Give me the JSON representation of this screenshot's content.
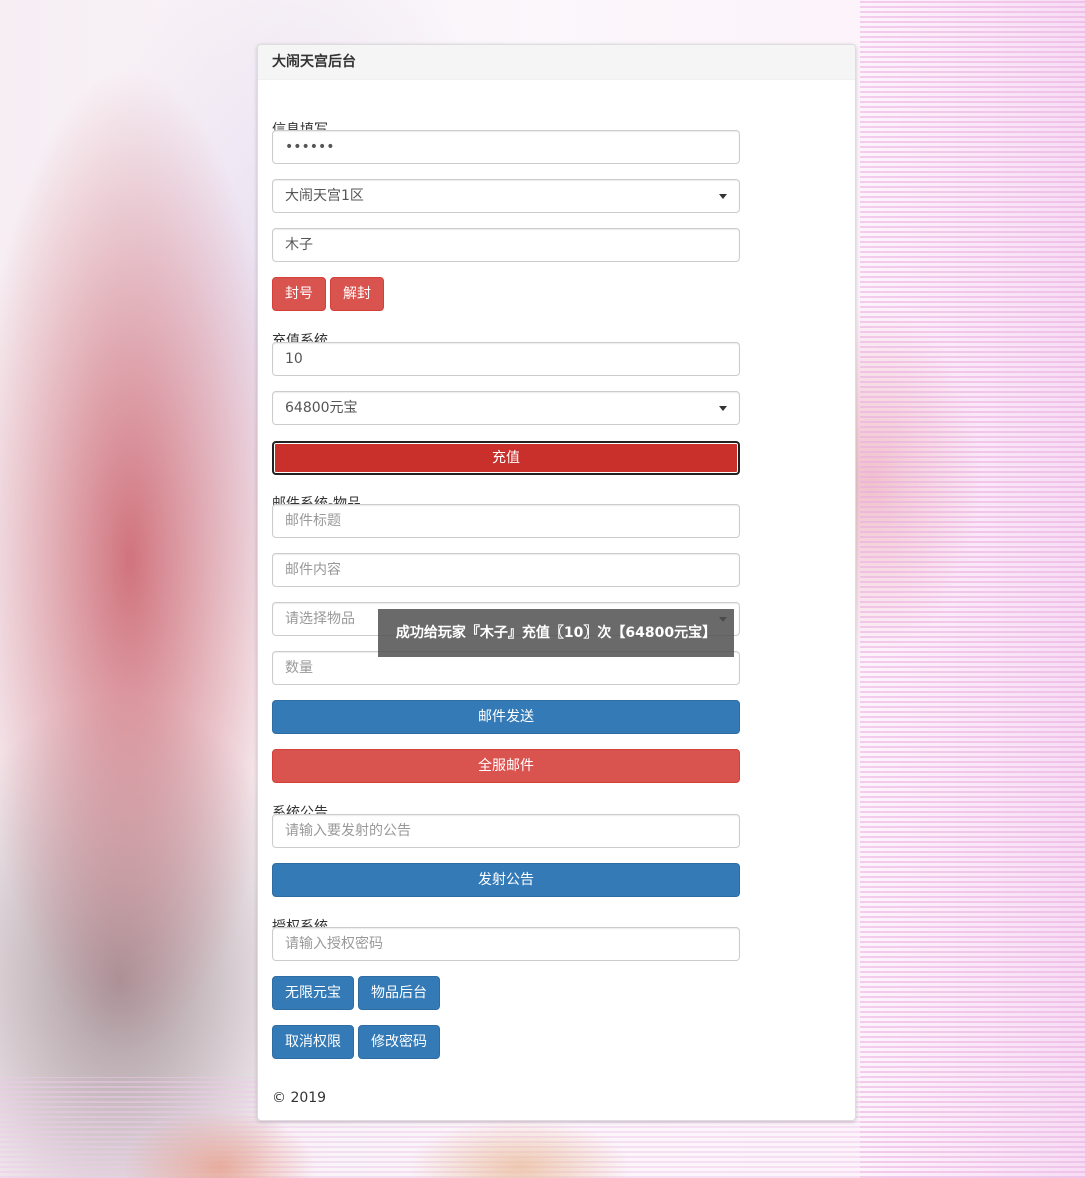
{
  "panel": {
    "title": "大闹天宫后台"
  },
  "info": {
    "section_label": "信息填写",
    "password_value": "••••••",
    "server_selected": "大闹天宫1区",
    "player_name": "木子",
    "ban_label": "封号",
    "unban_label": "解封"
  },
  "recharge": {
    "section_label": "充值系统",
    "count_value": "10",
    "package_selected": "64800元宝",
    "submit_label": "充值"
  },
  "mail": {
    "section_label": "邮件系统-物品",
    "title_placeholder": "邮件标题",
    "content_placeholder": "邮件内容",
    "item_placeholder": "请选择物品",
    "quantity_placeholder": "数量",
    "send_label": "邮件发送",
    "send_all_label": "全服邮件"
  },
  "announcement": {
    "section_label": "系统公告",
    "placeholder": "请输入要发射的公告",
    "send_label": "发射公告"
  },
  "auth": {
    "section_label": "授权系统",
    "password_placeholder": "请输入授权密码",
    "unlimited_label": "无限元宝",
    "items_admin_label": "物品后台",
    "revoke_label": "取消权限",
    "change_password_label": "修改密码"
  },
  "footer": {
    "copyright": "© 2019"
  },
  "toast": {
    "message": "成功给玩家『木子』充值〖10〗次【64800元宝】"
  },
  "colors": {
    "danger": "#d9534f",
    "danger_active": "#c9302c",
    "primary": "#337ab7"
  }
}
